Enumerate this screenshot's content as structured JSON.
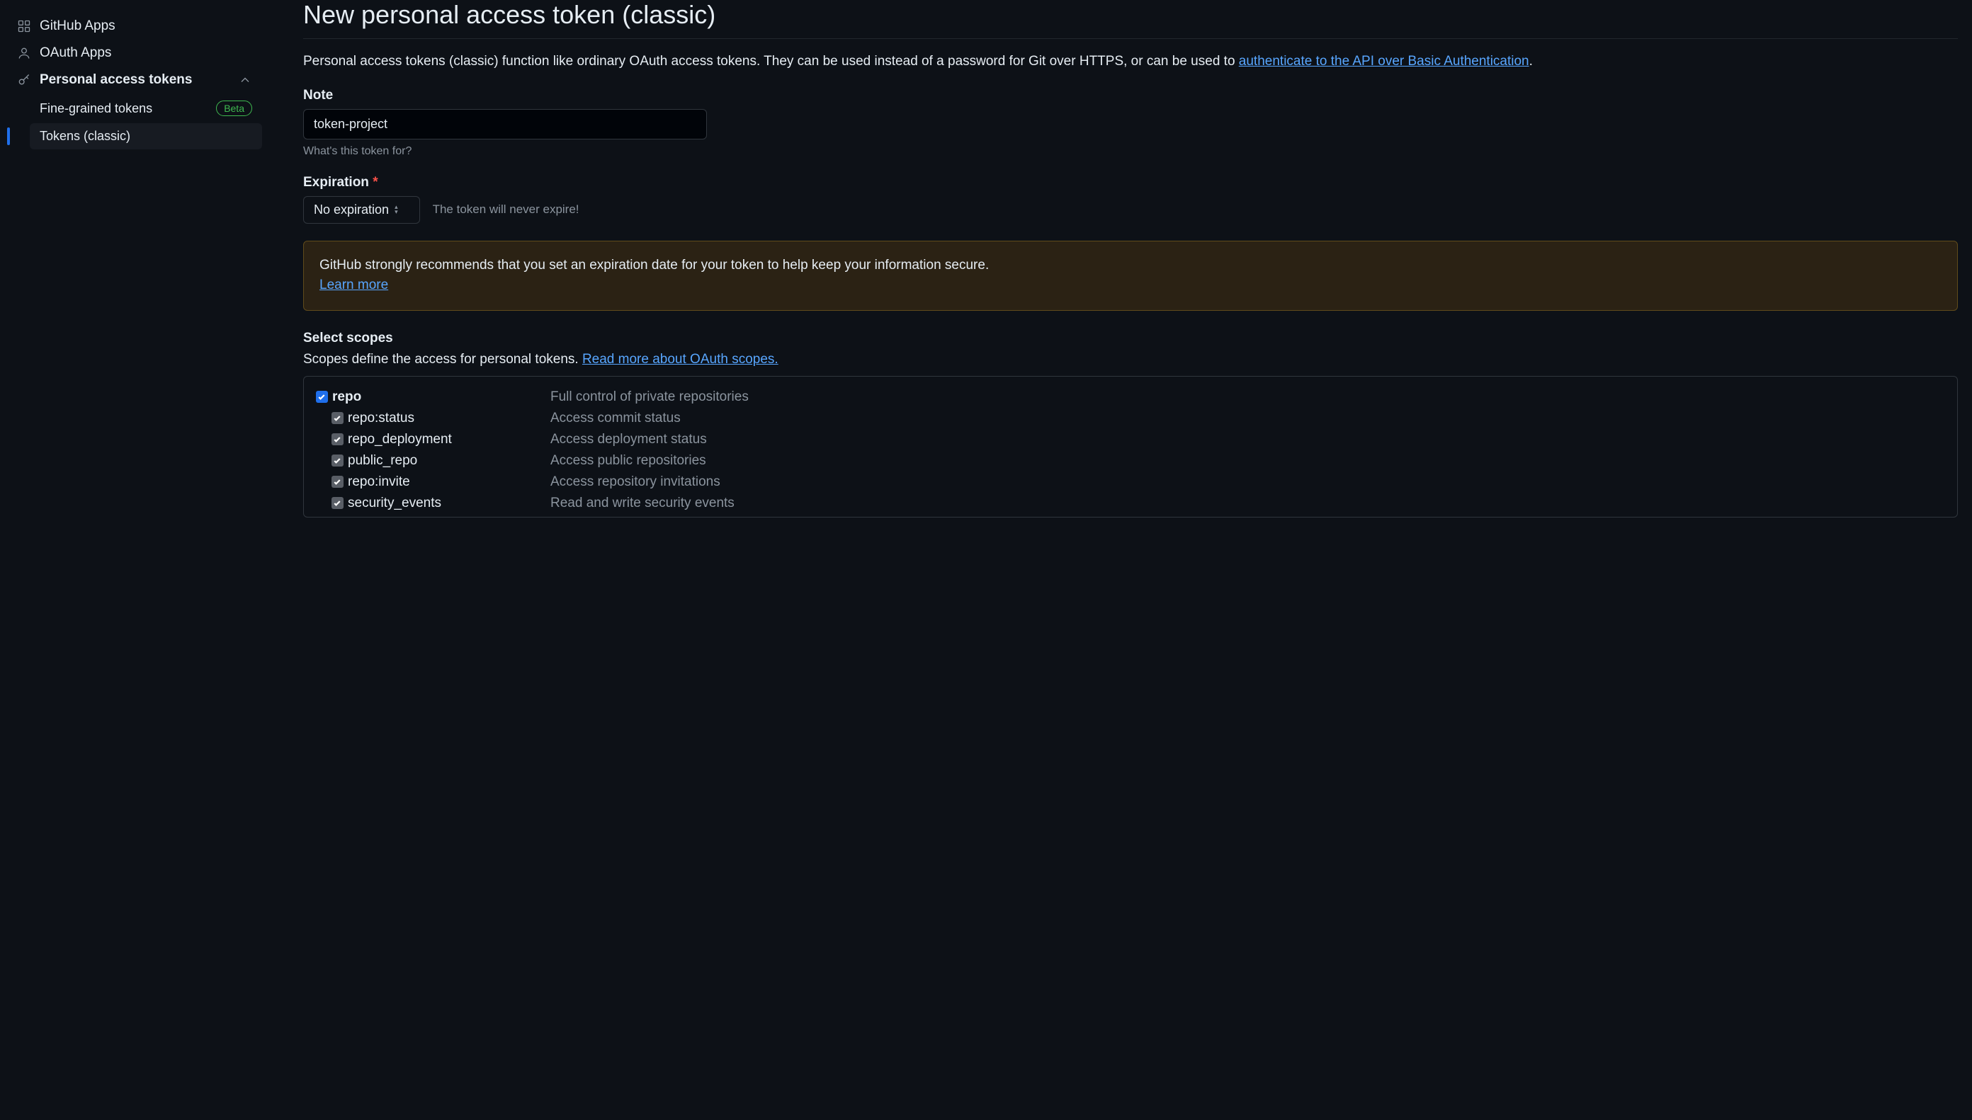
{
  "sidebar": {
    "github_apps": "GitHub Apps",
    "oauth_apps": "OAuth Apps",
    "pat": "Personal access tokens",
    "fine_grained": "Fine-grained tokens",
    "fine_grained_badge": "Beta",
    "tokens_classic": "Tokens (classic)"
  },
  "page": {
    "title": "New personal access token (classic)",
    "description_pre": "Personal access tokens (classic) function like ordinary OAuth access tokens. They can be used instead of a password for Git over HTTPS, or can be used to ",
    "description_link": "authenticate to the API over Basic Authentication",
    "description_post": "."
  },
  "note": {
    "label": "Note",
    "value": "token-project",
    "hint": "What's this token for?"
  },
  "expiration": {
    "label": "Expiration",
    "value": "No expiration",
    "note": "The token will never expire!"
  },
  "warning": {
    "text": "GitHub strongly recommends that you set an expiration date for your token to help keep your information secure.",
    "link": "Learn more"
  },
  "scopes": {
    "heading": "Select scopes",
    "intro_pre": "Scopes define the access for personal tokens. ",
    "intro_link": "Read more about OAuth scopes.",
    "items": [
      {
        "name": "repo",
        "desc": "Full control of private repositories",
        "parent": true,
        "style": "blue"
      },
      {
        "name": "repo:status",
        "desc": "Access commit status",
        "parent": false,
        "style": "grey"
      },
      {
        "name": "repo_deployment",
        "desc": "Access deployment status",
        "parent": false,
        "style": "grey"
      },
      {
        "name": "public_repo",
        "desc": "Access public repositories",
        "parent": false,
        "style": "grey"
      },
      {
        "name": "repo:invite",
        "desc": "Access repository invitations",
        "parent": false,
        "style": "grey"
      },
      {
        "name": "security_events",
        "desc": "Read and write security events",
        "parent": false,
        "style": "grey"
      }
    ]
  }
}
